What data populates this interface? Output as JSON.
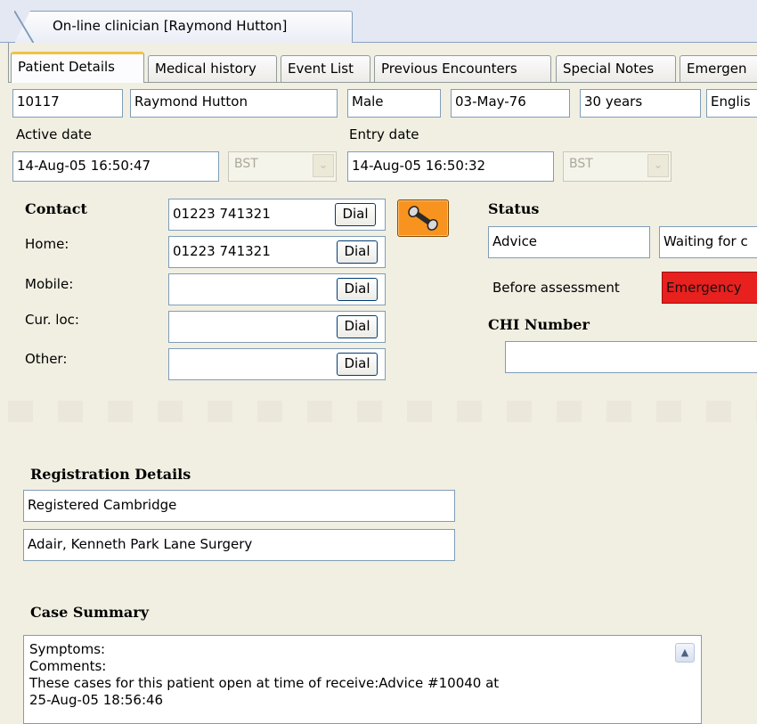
{
  "window": {
    "main_tab": "On-line clinician [Raymond Hutton]"
  },
  "tabs": [
    "Patient Details",
    "Medical history",
    "Event List",
    "Previous Encounters",
    "Special Notes",
    "Emergen"
  ],
  "patient": {
    "id": "10117",
    "name": "Raymond Hutton",
    "sex": "Male",
    "dob": "03-May-76",
    "age": "30 years",
    "language": "Englis"
  },
  "dates": {
    "active_label": "Active date",
    "active_value": "14-Aug-05 16:50:47",
    "active_tz": "BST",
    "entry_label": "Entry date",
    "entry_value": "14-Aug-05 16:50:32",
    "entry_tz": "BST"
  },
  "contact": {
    "heading": "Contact",
    "main_number": "01223 741321",
    "rows": [
      {
        "label": "Home:",
        "value": "01223 741321"
      },
      {
        "label": "Mobile:",
        "value": ""
      },
      {
        "label": "Cur. loc:",
        "value": ""
      },
      {
        "label": "Other:",
        "value": ""
      }
    ],
    "dial_label": "Dial",
    "phone_button_icon": "telephone-handset-icon",
    "phone_button_color": "#f7931e"
  },
  "status": {
    "heading": "Status",
    "value": "Advice",
    "waiting": "Waiting for c",
    "before_label": "Before assessment",
    "priority": "Emergency",
    "priority_color": "#e8201e"
  },
  "chi": {
    "heading": "CHI Number",
    "value": ""
  },
  "registration": {
    "heading": "Registration Details",
    "line1": "Registered Cambridge",
    "line2": "Adair, Kenneth Park Lane Surgery"
  },
  "case_summary": {
    "heading": "Case Summary",
    "lines": [
      "Symptoms:",
      "Comments:",
      "These cases for this patient open at time of receive:Advice #10040 at",
      "25-Aug-05 18:56:46"
    ]
  }
}
